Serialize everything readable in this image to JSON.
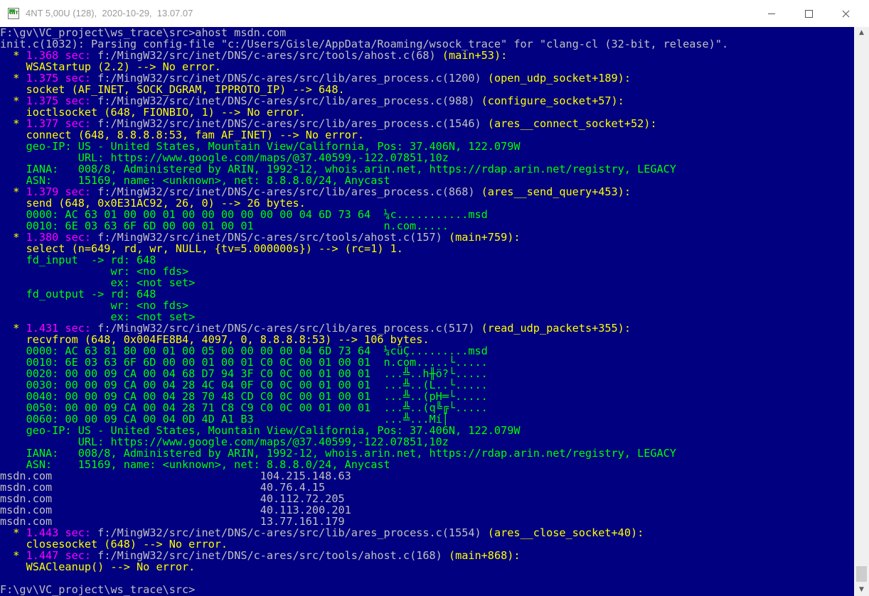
{
  "window": {
    "title": "4NT 5,00U (128),  2020-10-29,  13.07.07",
    "icon_label": "4NT",
    "minimize_label": "",
    "maximize_label": "",
    "close_label": ""
  },
  "scrollbar": {
    "up_glyph": "▲",
    "down_glyph": "▼"
  },
  "colors": {
    "console_background": "#000080",
    "white": "#c0c0c0",
    "yellow": "#ffff00",
    "green": "#00ff00",
    "magenta": "#ff00ff"
  },
  "console_lines": [
    [
      [
        "white",
        "F:\\gv\\VC_project\\ws_trace\\src>ahost msdn.com"
      ]
    ],
    [
      [
        "white",
        "init.c(1032): Parsing config-file \"c:/Users/Gisle/AppData/Roaming/wsock_trace\" for \"clang-cl (32-bit, release)\"."
      ]
    ],
    [
      [
        "yellow",
        "  * "
      ],
      [
        "magenta",
        "1.368 sec: "
      ],
      [
        "white",
        "f:/MingW32/src/inet/DNS/c-ares/src/tools/ahost.c(68) "
      ],
      [
        "yellow",
        "(main+53):"
      ]
    ],
    [
      [
        "yellow",
        "    WSAStartup (2.2) --> No error."
      ]
    ],
    [
      [
        "yellow",
        "  * "
      ],
      [
        "magenta",
        "1.375 sec: "
      ],
      [
        "white",
        "f:/MingW32/src/inet/DNS/c-ares/src/lib/ares_process.c(1200) "
      ],
      [
        "yellow",
        "(open_udp_socket+189):"
      ]
    ],
    [
      [
        "yellow",
        "    socket (AF_INET, SOCK_DGRAM, IPPROTO_IP) --> 648."
      ]
    ],
    [
      [
        "yellow",
        "  * "
      ],
      [
        "magenta",
        "1.375 sec: "
      ],
      [
        "white",
        "f:/MingW32/src/inet/DNS/c-ares/src/lib/ares_process.c(988) "
      ],
      [
        "yellow",
        "(configure_socket+57):"
      ]
    ],
    [
      [
        "yellow",
        "    ioctlsocket (648, FIONBIO, 1) --> No error."
      ]
    ],
    [
      [
        "yellow",
        "  * "
      ],
      [
        "magenta",
        "1.377 sec: "
      ],
      [
        "white",
        "f:/MingW32/src/inet/DNS/c-ares/src/lib/ares_process.c(1546) "
      ],
      [
        "yellow",
        "(ares__connect_socket+52):"
      ]
    ],
    [
      [
        "yellow",
        "    connect (648, 8.8.8.8:53, fam AF_INET) --> No error."
      ]
    ],
    [
      [
        "green",
        "    geo-IP: US - United States, Mountain View/California, Pos: 37.406N, 122.079W"
      ]
    ],
    [
      [
        "green",
        "            URL: https://www.google.com/maps/@37.40599,-122.07851,10z"
      ]
    ],
    [
      [
        "green",
        "    IANA:   008/8, Administered by ARIN, 1992-12, whois.arin.net, https://rdap.arin.net/registry, LEGACY"
      ]
    ],
    [
      [
        "green",
        "    ASN:    15169, name: <unknown>, net: 8.8.8.0/24, Anycast"
      ]
    ],
    [
      [
        "yellow",
        "  * "
      ],
      [
        "magenta",
        "1.379 sec: "
      ],
      [
        "white",
        "f:/MingW32/src/inet/DNS/c-ares/src/lib/ares_process.c(868) "
      ],
      [
        "yellow",
        "(ares__send_query+453):"
      ]
    ],
    [
      [
        "yellow",
        "    send (648, 0x0E31AC92, 26, 0) --> 26 bytes."
      ]
    ],
    [
      [
        "green",
        "    0000: AC 63 01 00 00 01 00 00 00 00 00 00 04 6D 73 64  ¼c...........msd"
      ]
    ],
    [
      [
        "green",
        "    0010: 6E 03 63 6F 6D 00 00 01 00 01                    n.com....."
      ]
    ],
    [
      [
        "yellow",
        "  * "
      ],
      [
        "magenta",
        "1.380 sec: "
      ],
      [
        "white",
        "f:/MingW32/src/inet/DNS/c-ares/src/tools/ahost.c(157) "
      ],
      [
        "yellow",
        "(main+759):"
      ]
    ],
    [
      [
        "yellow",
        "    select (n=649, rd, wr, NULL, {tv=5.000000s}) --> (rc=1) 1."
      ]
    ],
    [
      [
        "green",
        "    fd_input  -> rd: 648"
      ]
    ],
    [
      [
        "green",
        "                 wr: <no fds>"
      ]
    ],
    [
      [
        "green",
        "                 ex: <not set>"
      ]
    ],
    [
      [
        "green",
        "    fd_output -> rd: 648"
      ]
    ],
    [
      [
        "green",
        "                 wr: <no fds>"
      ]
    ],
    [
      [
        "green",
        "                 ex: <not set>"
      ]
    ],
    [
      [
        "yellow",
        "  * "
      ],
      [
        "magenta",
        "1.431 sec: "
      ],
      [
        "white",
        "f:/MingW32/src/inet/DNS/c-ares/src/lib/ares_process.c(517) "
      ],
      [
        "yellow",
        "(read_udp_packets+355):"
      ]
    ],
    [
      [
        "yellow",
        "    recvfrom (648, 0x004FE8B4, 4097, 0, 8.8.8.8:53) --> 106 bytes."
      ]
    ],
    [
      [
        "green",
        "    0000: AC 63 81 80 00 01 00 05 00 00 00 00 04 6D 73 64  ¼cüÇ.........msd"
      ]
    ],
    [
      [
        "green",
        "    0010: 6E 03 63 6F 6D 00 00 01 00 01 C0 0C 00 01 00 01  n.com.....└....."
      ]
    ],
    [
      [
        "green",
        "    0020: 00 00 09 CA 00 04 68 D7 94 3F C0 0C 00 01 00 01  ...╩..h╫ö?└....."
      ]
    ],
    [
      [
        "green",
        "    0030: 00 00 09 CA 00 04 28 4C 04 0F C0 0C 00 01 00 01  ...╩..(L..└....."
      ]
    ],
    [
      [
        "green",
        "    0040: 00 00 09 CA 00 04 28 70 48 CD C0 0C 00 01 00 01  ...╩..(pH═└....."
      ]
    ],
    [
      [
        "green",
        "    0050: 00 00 09 CA 00 04 28 71 C8 C9 C0 0C 00 01 00 01  ...╩..(q╚╔└....."
      ]
    ],
    [
      [
        "green",
        "    0060: 00 00 09 CA 00 04 0D 4D A1 B3                    ...╩...Mí│"
      ]
    ],
    [
      [
        "green",
        "    geo-IP: US - United States, Mountain View/California, Pos: 37.406N, 122.079W"
      ]
    ],
    [
      [
        "green",
        "            URL: https://www.google.com/maps/@37.40599,-122.07851,10z"
      ]
    ],
    [
      [
        "green",
        "    IANA:   008/8, Administered by ARIN, 1992-12, whois.arin.net, https://rdap.arin.net/registry, LEGACY"
      ]
    ],
    [
      [
        "green",
        "    ASN:    15169, name: <unknown>, net: 8.8.8.0/24, Anycast"
      ]
    ],
    [
      [
        "white",
        "msdn.com                                104.215.148.63"
      ]
    ],
    [
      [
        "white",
        "msdn.com                                40.76.4.15"
      ]
    ],
    [
      [
        "white",
        "msdn.com                                40.112.72.205"
      ]
    ],
    [
      [
        "white",
        "msdn.com                                40.113.200.201"
      ]
    ],
    [
      [
        "white",
        "msdn.com                                13.77.161.179"
      ]
    ],
    [
      [
        "yellow",
        "  * "
      ],
      [
        "magenta",
        "1.443 sec: "
      ],
      [
        "white",
        "f:/MingW32/src/inet/DNS/c-ares/src/lib/ares_process.c(1554) "
      ],
      [
        "yellow",
        "(ares__close_socket+40):"
      ]
    ],
    [
      [
        "yellow",
        "    closesocket (648) --> No error."
      ]
    ],
    [
      [
        "yellow",
        "  * "
      ],
      [
        "magenta",
        "1.447 sec: "
      ],
      [
        "white",
        "f:/MingW32/src/inet/DNS/c-ares/src/tools/ahost.c(168) "
      ],
      [
        "yellow",
        "(main+868):"
      ]
    ],
    [
      [
        "yellow",
        "    WSACleanup() --> No error."
      ]
    ],
    [
      [
        "white",
        ""
      ]
    ],
    [
      [
        "white",
        "F:\\gv\\VC_project\\ws_trace\\src>"
      ]
    ]
  ]
}
